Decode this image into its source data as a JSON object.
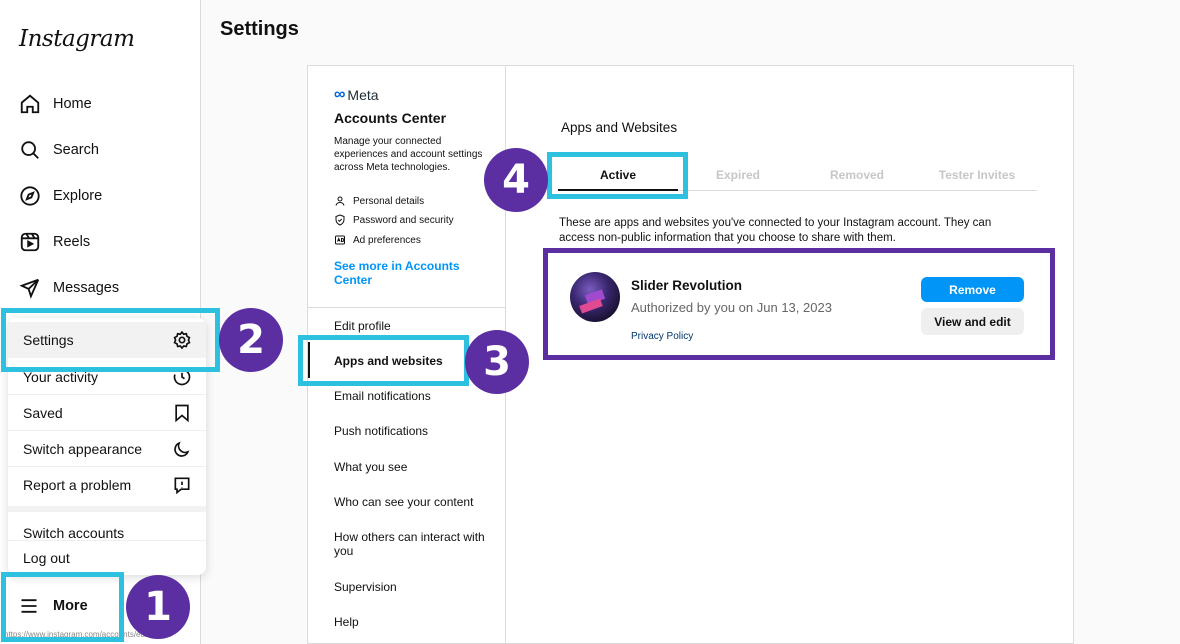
{
  "sidebar": {
    "logo": "Instagram",
    "items": [
      {
        "label": "Home",
        "icon": "home-icon"
      },
      {
        "label": "Search",
        "icon": "search-icon"
      },
      {
        "label": "Explore",
        "icon": "compass-icon"
      },
      {
        "label": "Reels",
        "icon": "reels-icon"
      },
      {
        "label": "Messages",
        "icon": "send-icon"
      }
    ],
    "more_label": "More",
    "status_url": "https://www.instagram.com/accounts/edit/"
  },
  "more_menu": {
    "items": [
      {
        "label": "Settings",
        "icon": "gear-icon"
      },
      {
        "label": "Your activity",
        "icon": "activity-icon"
      },
      {
        "label": "Saved",
        "icon": "bookmark-icon"
      },
      {
        "label": "Switch appearance",
        "icon": "moon-icon"
      },
      {
        "label": "Report a problem",
        "icon": "report-icon"
      }
    ],
    "switch_accounts": "Switch accounts",
    "log_out": "Log out"
  },
  "settings": {
    "title": "Settings",
    "meta_logo": "Meta",
    "accounts_center": {
      "title": "Accounts Center",
      "description": "Manage your connected experiences and account settings across Meta technologies.",
      "links": [
        {
          "label": "Personal details",
          "icon": "person-icon"
        },
        {
          "label": "Password and security",
          "icon": "shield-icon"
        },
        {
          "label": "Ad preferences",
          "icon": "ad-icon"
        }
      ],
      "see_more": "See more in Accounts Center"
    },
    "nav": [
      "Edit profile",
      "Apps and websites",
      "Email notifications",
      "Push notifications",
      "What you see",
      "Who can see your content",
      "How others can interact with you",
      "Supervision",
      "Help"
    ],
    "active_nav": "Apps and websites"
  },
  "apps": {
    "title": "Apps and Websites",
    "tabs": [
      "Active",
      "Expired",
      "Removed",
      "Tester Invites"
    ],
    "active_tab": "Active",
    "description": "These are apps and websites you've connected to your Instagram account. They can access non-public information that you choose to share with them.",
    "app": {
      "name": "Slider Revolution",
      "authorized": "Authorized by you on Jun 13, 2023",
      "privacy": "Privacy Policy",
      "remove_label": "Remove",
      "view_label": "View and edit"
    }
  },
  "annotations": {
    "badges": [
      "1",
      "2",
      "3",
      "4"
    ],
    "highlight_color": "#2ec0df",
    "badge_color": "#5b2ea2"
  }
}
